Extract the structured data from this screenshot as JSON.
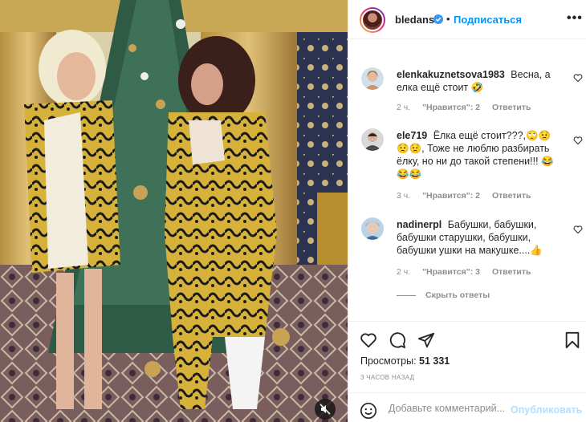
{
  "header": {
    "username": "bledans",
    "dot": "•",
    "follow_label": "Подписаться",
    "more_label": "•••"
  },
  "comments": [
    {
      "username": "elenkakuznetsova1983",
      "text": "Весна, а елка ещё стоит 🤣",
      "time": "2 ч.",
      "likes": "\"Нравится\": 2",
      "reply": "Ответить"
    },
    {
      "username": "ele719",
      "text": "Ёлка ещё стоит???,🙄😟😟😟, Тоже не люблю разбирать ёлку, но ни до такой степени!!! 😂😂😂",
      "time": "3 ч.",
      "likes": "\"Нравится\": 2",
      "reply": "Ответить"
    },
    {
      "username": "nadinerpl",
      "text": "Бабушки, бабушки, бабушки старушки, бабушки, бабушки ушки на макушке....👍",
      "time": "2 ч.",
      "likes": "\"Нравится\": 3",
      "reply": "Ответить"
    }
  ],
  "hide_replies": "Скрыть ответы",
  "stats": {
    "views_label": "Просмотры:",
    "views_value": "51 331",
    "time_ago": "3 ЧАСОВ НАЗАД"
  },
  "add_comment": {
    "placeholder": "Добавьте комментарий...",
    "post_label": "Опубликовать"
  },
  "icons": {
    "verified": "verified-badge-icon",
    "heart": "heart-icon",
    "comment": "comment-icon",
    "share": "paper-plane-icon",
    "save": "bookmark-icon",
    "emoji": "smiley-icon",
    "mute": "mute-icon"
  },
  "colors": {
    "accent": "#0095f6",
    "post_disabled": "#b2dffc",
    "muted_text": "#8e8e8e"
  }
}
